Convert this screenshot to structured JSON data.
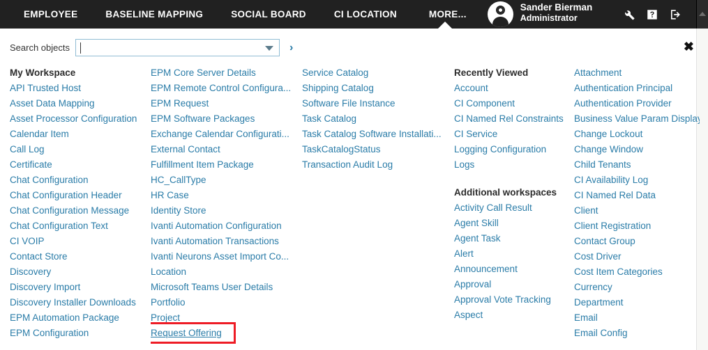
{
  "topbar": {
    "tabs": [
      {
        "label": "EMPLOYEE",
        "active": false
      },
      {
        "label": "BASELINE MAPPING",
        "active": false
      },
      {
        "label": "SOCIAL BOARD",
        "active": false
      },
      {
        "label": "CI LOCATION",
        "active": false
      },
      {
        "label": "MORE...",
        "active": true
      }
    ],
    "user": {
      "name": "Sander Bierman",
      "role": "Administrator"
    },
    "icons": [
      "wrench-icon",
      "help-icon",
      "logout-icon"
    ],
    "accent_color": "#2a7ca8",
    "bar_color": "#212121"
  },
  "search": {
    "label": "Search objects",
    "value": "",
    "placeholder": "",
    "submit_glyph": "›",
    "dropdown_icon": "chevron-down-icon"
  },
  "panel": {
    "close_glyph": "✖"
  },
  "columns": [
    {
      "heading": "My Workspace",
      "items": [
        "API Trusted Host",
        "Asset Data Mapping",
        "Asset Processor Configuration",
        "Calendar Item",
        "Call Log",
        "Certificate",
        "Chat Configuration",
        "Chat Configuration Header",
        "Chat Configuration Message",
        "Chat Configuration Text",
        "CI VOIP",
        "Contact Store",
        "Discovery",
        "Discovery Import",
        "Discovery Installer Downloads",
        "EPM Automation Package",
        "EPM Configuration"
      ]
    },
    {
      "heading": "",
      "items": [
        "EPM Core Server Details",
        "EPM Remote Control Configura...",
        "EPM Request",
        "EPM Software Packages",
        "Exchange Calendar Configurati...",
        "External Contact",
        "Fulfillment Item Package",
        "HC_CallType",
        "HR Case",
        "Identity Store",
        "Ivanti Automation Configuration",
        "Ivanti Automation Transactions",
        "Ivanti Neurons Asset Import Co...",
        "Location",
        "Microsoft Teams User Details",
        "Portfolio",
        "Project",
        "Request Offering"
      ],
      "highlight_item": "Request Offering",
      "highlight_color": "#ee1c25"
    },
    {
      "heading": "",
      "items": [
        "Service Catalog",
        "Shipping Catalog",
        "Software File Instance",
        "Task Catalog",
        "Task Catalog Software Installati...",
        "TaskCatalogStatus",
        "Transaction Audit Log"
      ]
    },
    {
      "heading": "Recently Viewed",
      "items": [
        "Account",
        "CI Component",
        "CI Named Rel Constraints",
        "CI Service",
        "Logging Configuration",
        "Logs"
      ],
      "heading2": "Additional workspaces",
      "items2": [
        "Activity Call Result",
        "Agent Skill",
        "Agent Task",
        "Alert",
        "Announcement",
        "Approval",
        "Approval Vote Tracking",
        "Aspect"
      ]
    },
    {
      "heading": "",
      "items": [
        "Attachment",
        "Authentication Principal",
        "Authentication Provider",
        "Business Value Param Display .",
        "Change Lockout",
        "Change Window",
        "Child Tenants",
        "CI Availability Log",
        "CI Named Rel Data",
        "Client",
        "Client Registration",
        "Contact Group",
        "Cost Driver",
        "Cost Item Categories",
        "Currency",
        "Department",
        "Email",
        "Email Config"
      ]
    }
  ]
}
